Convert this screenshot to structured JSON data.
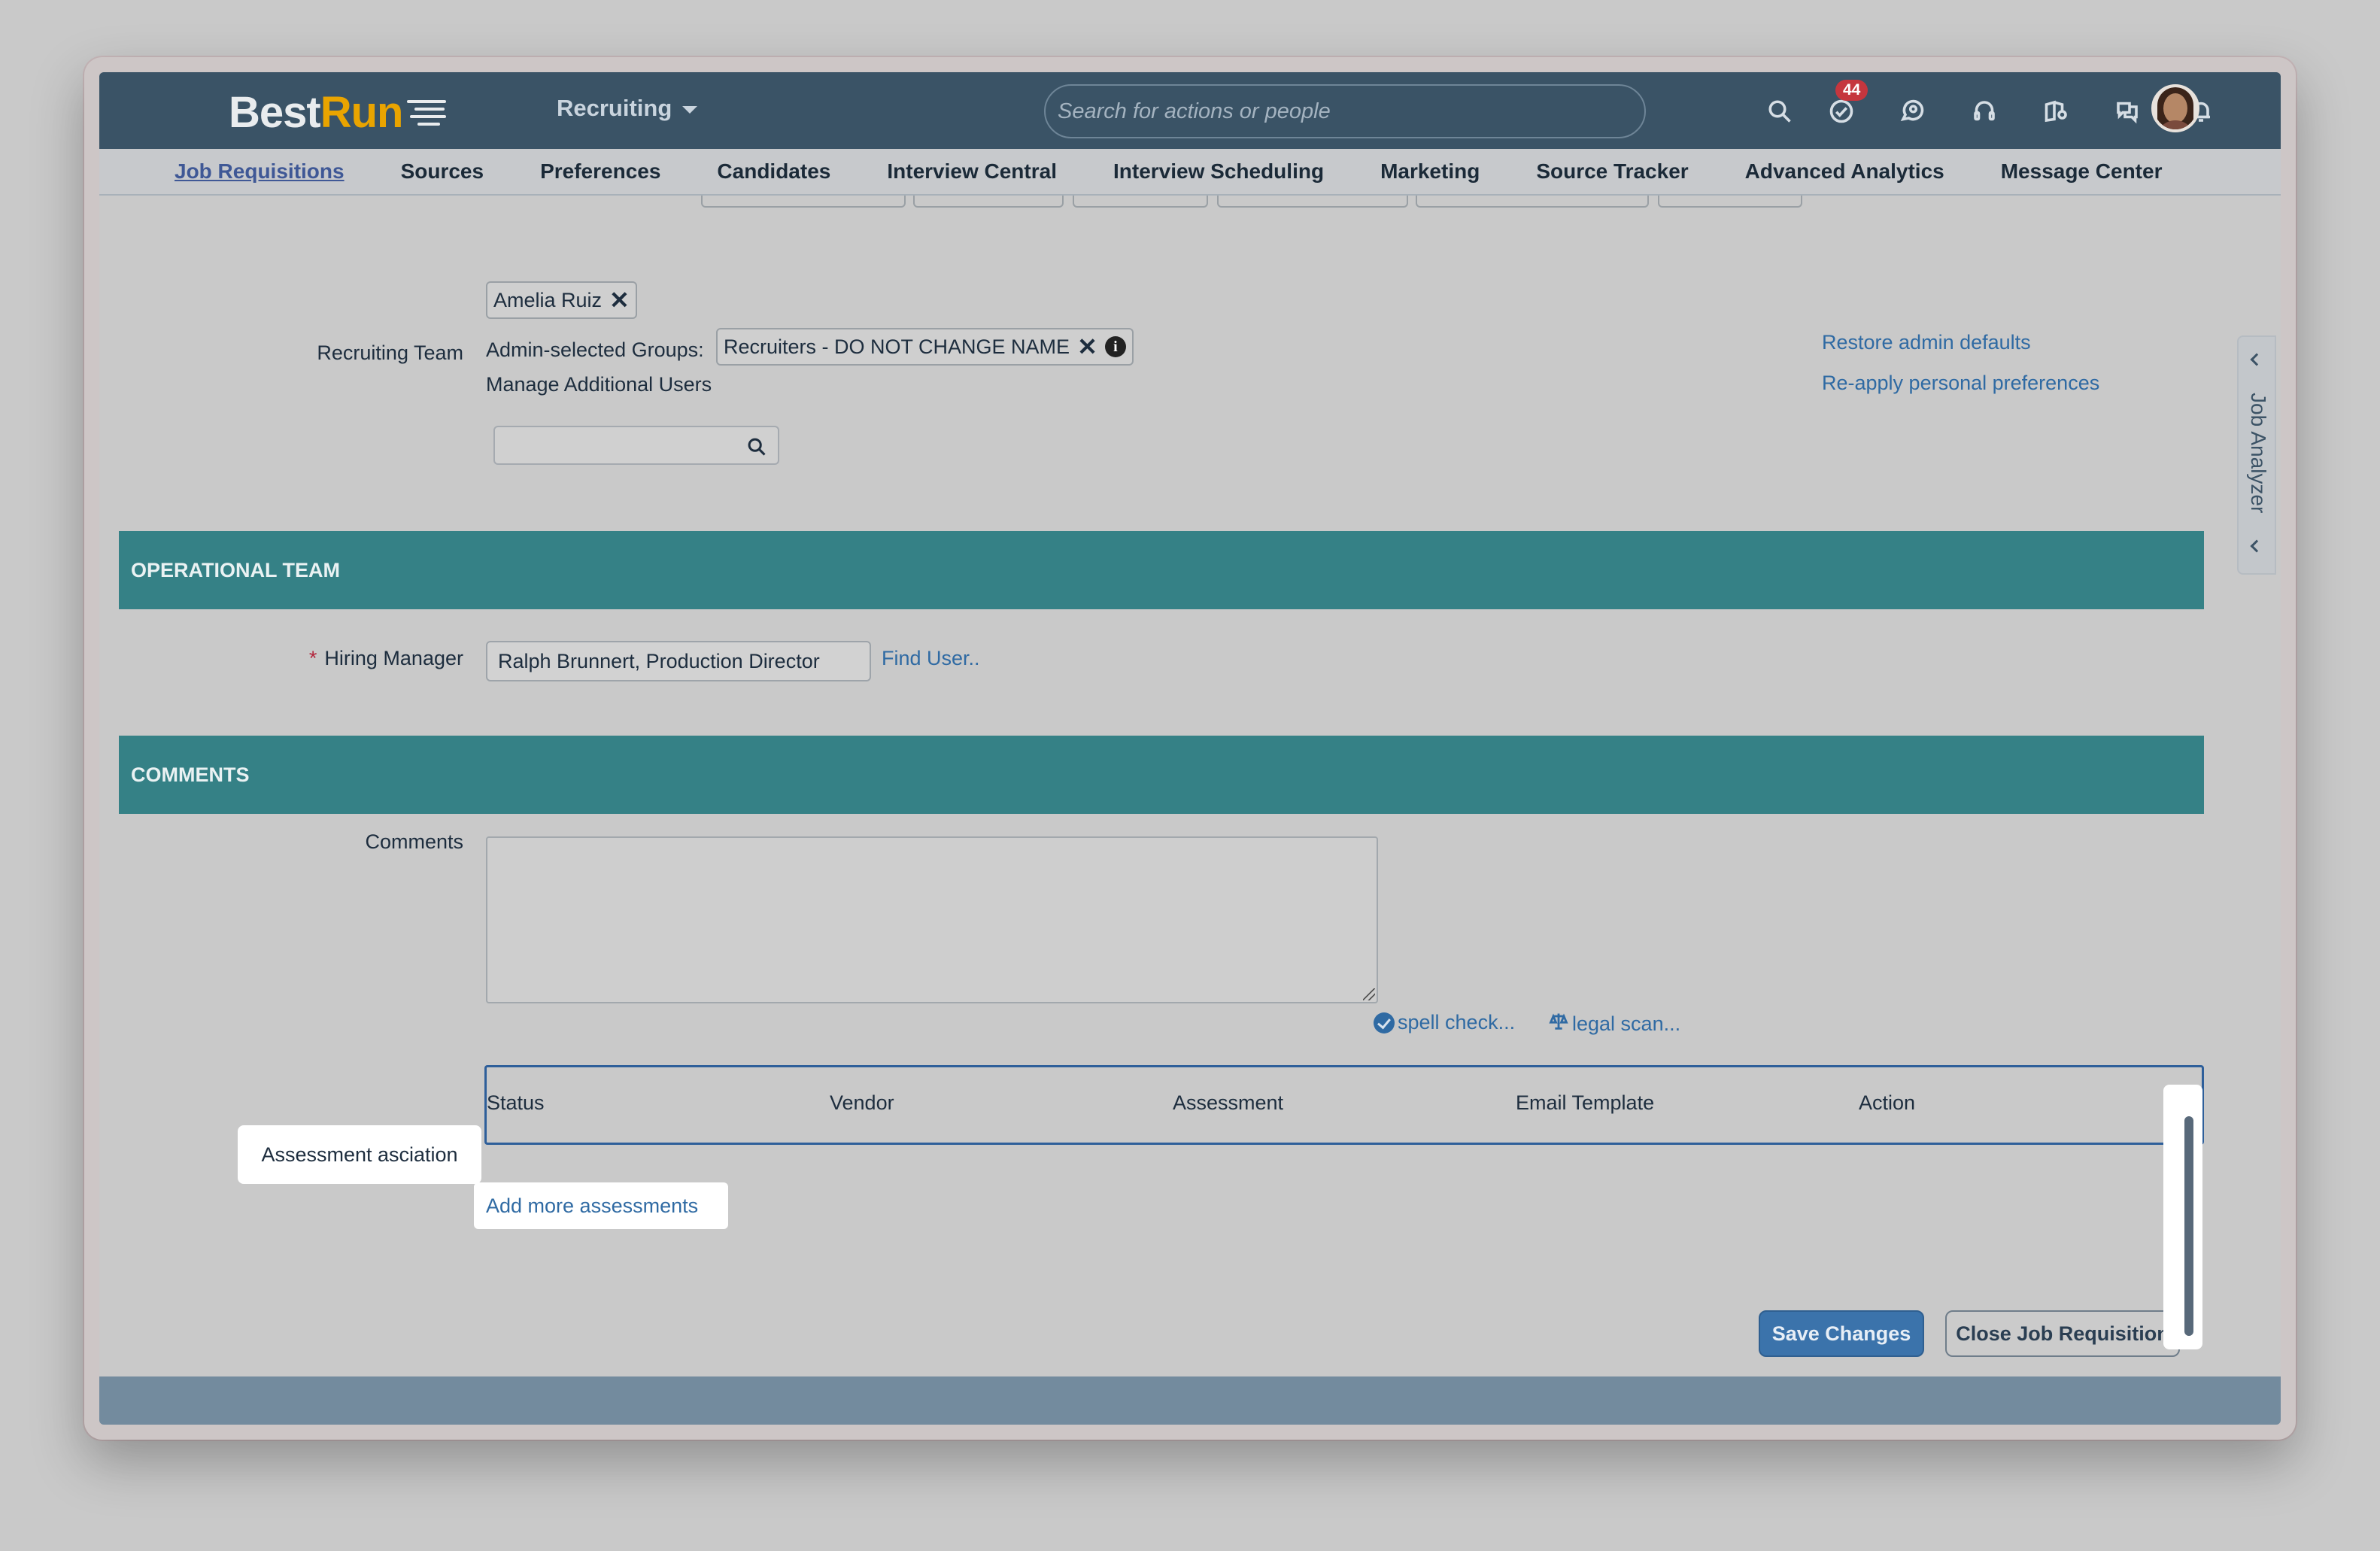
{
  "header": {
    "logo_best": "Best",
    "logo_run": "Run",
    "module": "Recruiting",
    "search_placeholder": "Search for actions or people",
    "todo_badge": "44",
    "icons": [
      "search-icon",
      "todo-icon",
      "chat-icon",
      "headset-icon",
      "learning-icon",
      "feedback-icon",
      "notification-icon"
    ]
  },
  "nav": {
    "items": [
      "Job Requisitions",
      "Sources",
      "Preferences",
      "Candidates",
      "Interview Central",
      "Interview Scheduling",
      "Marketing",
      "Source Tracker",
      "Advanced Analytics",
      "Message Center"
    ],
    "active": "Job Requisitions"
  },
  "recruiting_team": {
    "label": "Recruiting Team",
    "user_token": "Amelia Ruiz",
    "groups_label": "Admin-selected Groups:",
    "group_token": "Recruiters - DO NOT CHANGE NAME",
    "manage_label": "Manage Additional Users",
    "restore_link": "Restore admin defaults",
    "reapply_link": "Re-apply personal preferences"
  },
  "operational_team": {
    "title": "OPERATIONAL TEAM",
    "hiring_manager_label": "Hiring Manager",
    "hiring_manager_value": "Ralph Brunnert, Production Director",
    "find_user": "Find User.."
  },
  "comments": {
    "title": "COMMENTS",
    "label": "Comments",
    "spell_check": "spell check...",
    "legal_scan": "legal scan..."
  },
  "assessment": {
    "label": "Assessment asciation",
    "columns": [
      "Status",
      "Vendor",
      "Assessment",
      "Email Template",
      "Action"
    ],
    "add_more": "Add more assessments"
  },
  "actions": {
    "save": "Save Changes",
    "close": "Close Job Requisition"
  },
  "side_panel": {
    "label": "Job Analyzer"
  },
  "colors": {
    "shellbar": "#3a5366",
    "section_header": "#358186",
    "primary_button": "#3b73ab",
    "link": "#2f6aa3",
    "badge": "#c5363e"
  }
}
